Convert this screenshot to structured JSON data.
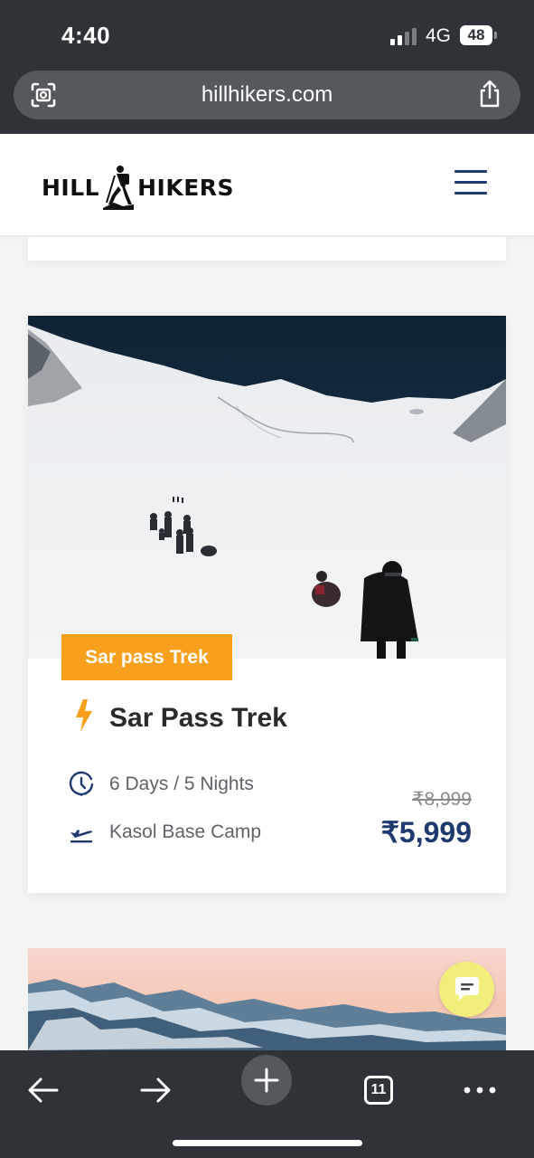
{
  "status_bar": {
    "time": "4:40",
    "network": "4G",
    "battery": "48"
  },
  "browser": {
    "url": "hillhikers.com",
    "tab_count": "11",
    "icons": [
      "lens-icon",
      "share-icon",
      "back-arrow-icon",
      "forward-arrow-icon",
      "plus-icon",
      "tabs-icon",
      "more-icon"
    ]
  },
  "header": {
    "logo_left": "HILL",
    "logo_right": "HIKERS"
  },
  "card": {
    "badge": "Sar pass Trek",
    "title": "Sar Pass Trek",
    "duration": "6 Days / 5 Nights",
    "base_camp": "Kasol Base Camp",
    "price_old": "₹8,999",
    "price_new": "₹5,999"
  },
  "colors": {
    "accent": "#f7a01d",
    "brand_blue": "#1e3a6e",
    "chrome": "#2f3337",
    "chat_button": "#f1ee7b"
  }
}
